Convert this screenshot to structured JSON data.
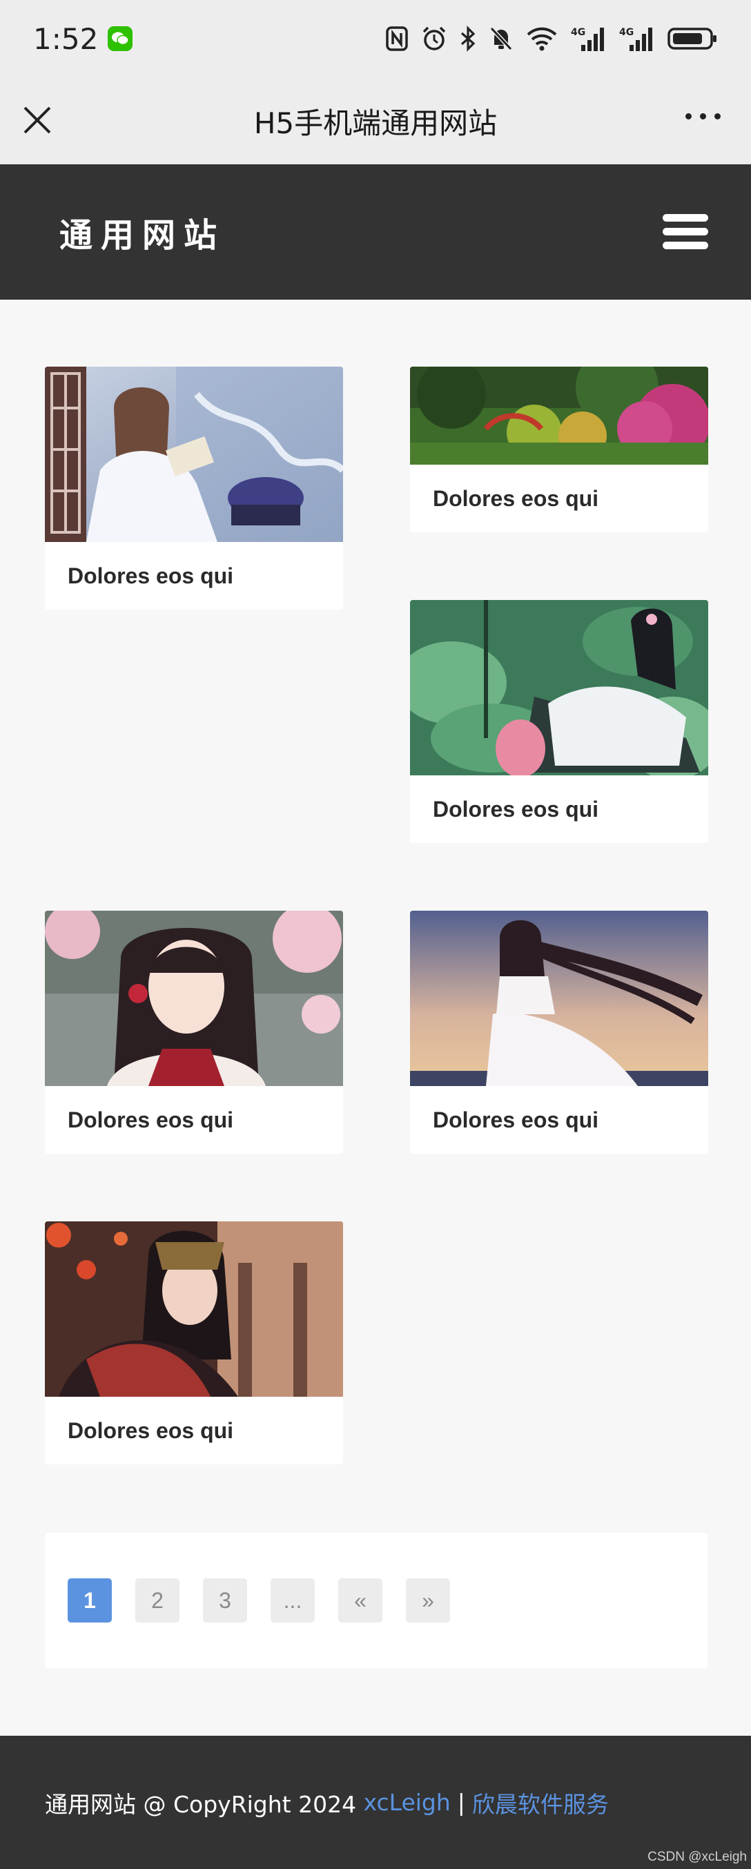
{
  "status_bar": {
    "time": "1:52",
    "wechat_icon": "wechat-icon",
    "icons": [
      "nfc-icon",
      "alarm-icon",
      "bluetooth-icon",
      "mute-icon",
      "wifi-icon",
      "signal-4g-icon",
      "signal-4g-icon",
      "battery-icon"
    ],
    "net_label_1": "4G",
    "net_label_2": "4G"
  },
  "nav_bar": {
    "title": "H5手机端通用网站",
    "close_icon": "close-icon",
    "more_icon": "more-icon"
  },
  "site_header": {
    "logo_text": "通用网站",
    "menu_icon": "hamburger-menu-icon"
  },
  "gallery": {
    "items": [
      {
        "caption": "Dolores eos qui"
      },
      {
        "caption": "Dolores eos qui"
      },
      {
        "caption": "Dolores eos qui"
      },
      {
        "caption": "Dolores eos qui"
      },
      {
        "caption": "Dolores eos qui"
      },
      {
        "caption": "Dolores eos qui"
      }
    ]
  },
  "pagination": {
    "pages": [
      "1",
      "2",
      "3",
      "...",
      "«",
      "»"
    ],
    "active": "1"
  },
  "footer": {
    "text": "通用网站 @ CopyRight 2024 ",
    "author_link": "xcLeigh",
    "separator": "|",
    "service_link": "欣晨软件服务"
  },
  "watermark": "CSDN @xcLeigh",
  "colors": {
    "header_bg": "#333333",
    "page_bg": "#f7f7f7",
    "accent": "#5b93e0",
    "system_bar_bg": "#ededed"
  }
}
